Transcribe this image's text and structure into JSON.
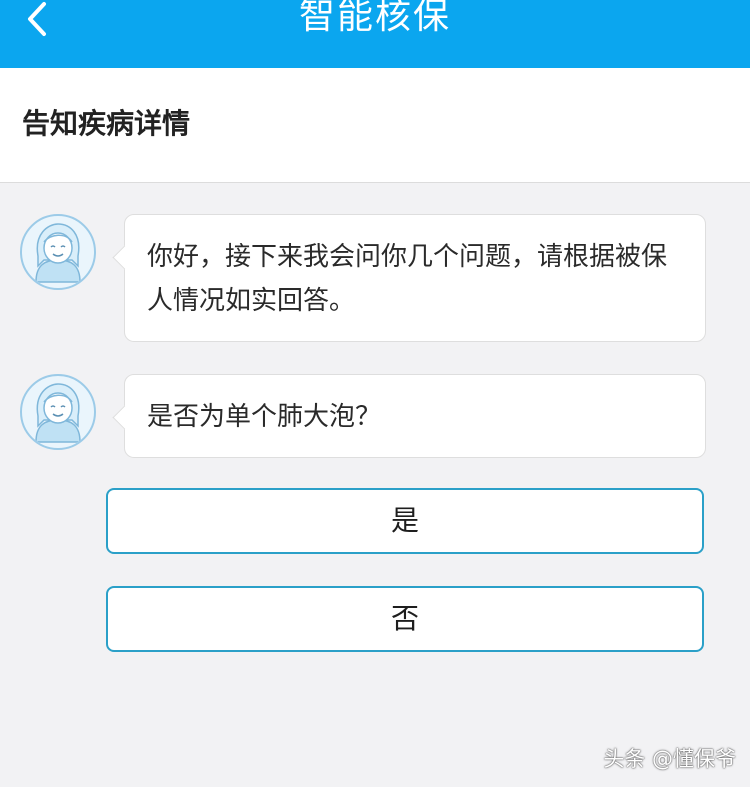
{
  "nav": {
    "title": "智能核保",
    "back_icon": "chevron-left-icon"
  },
  "header": {
    "title": "告知疾病详情"
  },
  "messages": [
    {
      "avatar": "assistant-avatar",
      "text": "你好，接下来我会问你几个问题，请根据被保人情况如实回答。"
    },
    {
      "avatar": "assistant-avatar",
      "text": "是否为单个肺大泡？"
    }
  ],
  "answers": [
    {
      "label": "是"
    },
    {
      "label": "否"
    }
  ],
  "watermark": "头条 @懂保爷",
  "colors": {
    "nav_background": "#0ba6ef",
    "answer_border": "#2ba0c8",
    "page_background": "#f2f2f4"
  }
}
